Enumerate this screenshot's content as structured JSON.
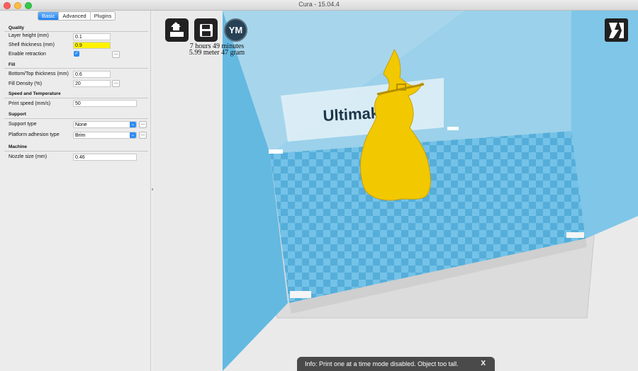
{
  "window": {
    "title": "Cura - 15.04.4"
  },
  "tabs": [
    "Basic",
    "Advanced",
    "Plugins"
  ],
  "sections": {
    "quality": "Quality",
    "fill": "Fill",
    "speed": "Speed and Temperature",
    "support": "Support",
    "machine": "Machine"
  },
  "fields": {
    "layer_height": {
      "label": "Layer height (mm)",
      "value": "0.1"
    },
    "shell_thickness": {
      "label": "Shell thickness (mm)",
      "value": "0.9"
    },
    "enable_retraction": {
      "label": "Enable retraction",
      "checked": "✓"
    },
    "bottom_top": {
      "label": "Bottom/Top thickness (mm)",
      "value": "0.6"
    },
    "fill_density": {
      "label": "Fill Density (%)",
      "value": "20"
    },
    "print_speed": {
      "label": "Print speed (mm/s)",
      "value": "50"
    },
    "support_type": {
      "label": "Support type",
      "value": "None"
    },
    "platform_adhesion": {
      "label": "Platform adhesion type",
      "value": "Brim"
    },
    "nozzle_size": {
      "label": "Nozzle size (mm)",
      "value": "0.46"
    }
  },
  "dots_label": "...",
  "toolbar": {
    "load_icon": "load-icon",
    "save_icon": "save-icon",
    "ym_label": "YM",
    "view_icon": "view-mode-icon"
  },
  "stats": {
    "time": "7 hours 49 minutes",
    "material": "5.99 meter 47 gram"
  },
  "viewport": {
    "brand_text": "Ultimaker"
  },
  "toast": {
    "message": "Info: Print one at a time mode disabled. Object too tall.",
    "close": "X"
  },
  "colors": {
    "object": "#f2c800",
    "build_volume": "#5fb6dd",
    "accent": "#2f8cf4",
    "highlight": "#fff200"
  }
}
